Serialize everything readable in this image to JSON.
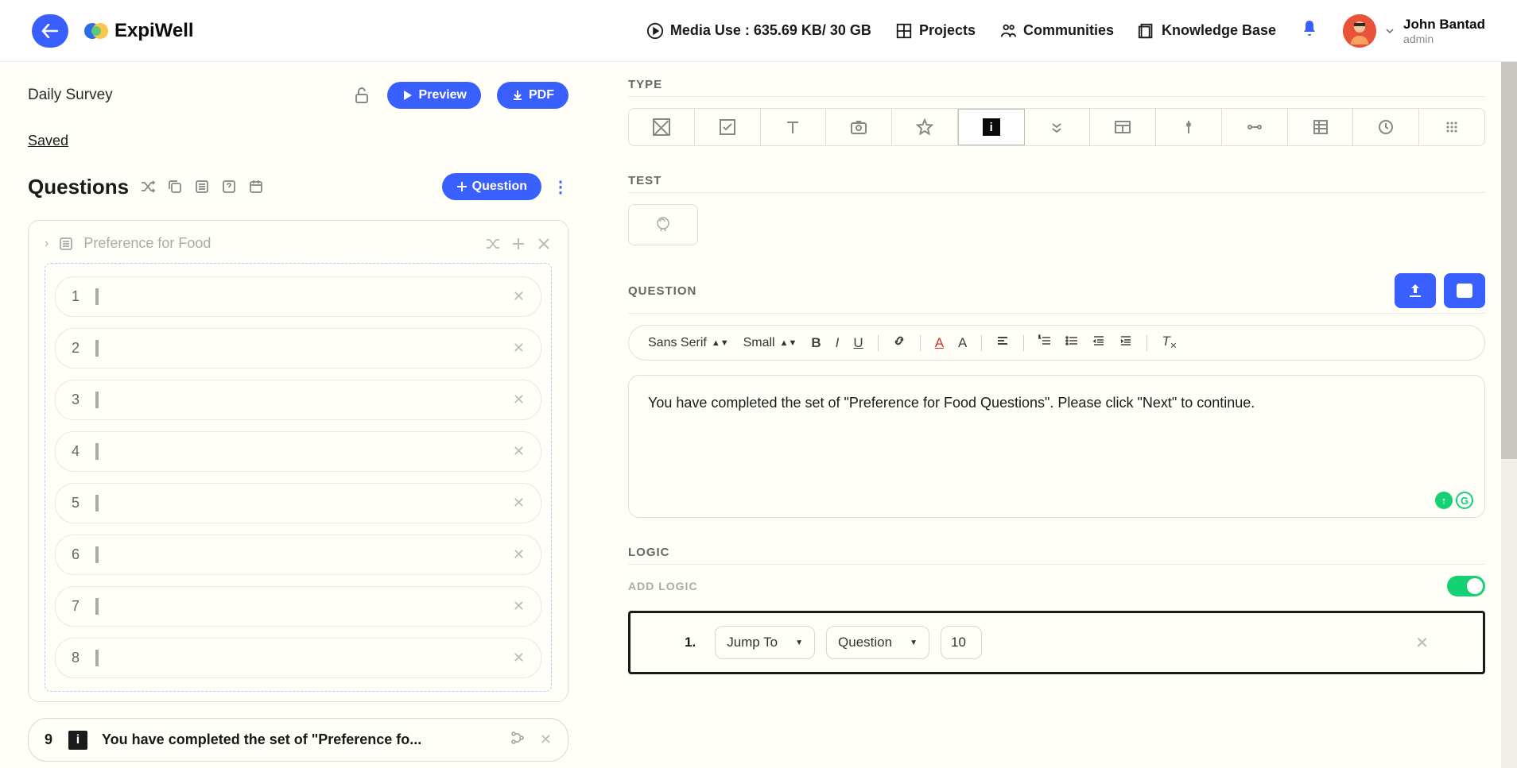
{
  "header": {
    "logo_text": "ExpiWell",
    "media_use": "Media Use : 635.69 KB/ 30 GB",
    "nav": {
      "projects": "Projects",
      "communities": "Communities",
      "knowledge_base": "Knowledge Base"
    },
    "user": {
      "name": "John Bantad",
      "role": "admin"
    }
  },
  "left": {
    "survey_title": "Daily Survey",
    "preview_btn": "Preview",
    "pdf_btn": "PDF",
    "saved": "Saved",
    "questions_title": "Questions",
    "question_btn": "Question",
    "block_title": "Preference for Food",
    "questions": [
      {
        "num": "1"
      },
      {
        "num": "2"
      },
      {
        "num": "3"
      },
      {
        "num": "4"
      },
      {
        "num": "5"
      },
      {
        "num": "6"
      },
      {
        "num": "7"
      },
      {
        "num": "8"
      }
    ],
    "selected": {
      "num": "9",
      "text": "You have completed the set of \"Preference fo..."
    }
  },
  "right": {
    "type_label": "TYPE",
    "test_label": "TEST",
    "question_label": "QUESTION",
    "toolbar": {
      "font": "Sans Serif",
      "size": "Small"
    },
    "editor_text": "You have completed the set of \"Preference for Food Questions\".  Please click \"Next\" to continue.",
    "logic_label": "LOGIC",
    "add_logic_label": "ADD LOGIC",
    "logic_row": {
      "num": "1.",
      "action": "Jump To",
      "target": "Question",
      "value": "10"
    }
  }
}
